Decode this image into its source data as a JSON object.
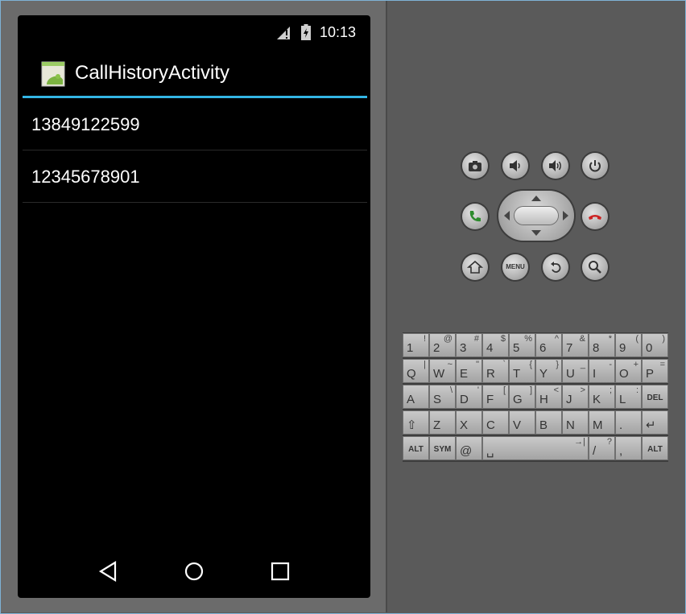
{
  "status_bar": {
    "time": "10:13"
  },
  "action_bar": {
    "title": "CallHistoryActivity"
  },
  "call_history": {
    "items": [
      {
        "number": "13849122599"
      },
      {
        "number": "12345678901"
      }
    ]
  },
  "colors": {
    "accent": "#33b5e5",
    "call_green": "#2e8b2e",
    "end_red": "#cc2222"
  },
  "hardware_buttons": {
    "row1": [
      "camera-icon",
      "volume-down-icon",
      "volume-up-icon",
      "power-icon"
    ],
    "row2": [
      "call-icon",
      "dpad",
      "end-call-icon"
    ],
    "row3": [
      "home-icon",
      "menu-button",
      "back-icon",
      "search-icon"
    ],
    "menu_label": "MENU"
  },
  "keyboard": {
    "rows": [
      [
        {
          "main": "1",
          "alt": "!"
        },
        {
          "main": "2",
          "alt": "@"
        },
        {
          "main": "3",
          "alt": "#"
        },
        {
          "main": "4",
          "alt": "$"
        },
        {
          "main": "5",
          "alt": "%"
        },
        {
          "main": "6",
          "alt": "^"
        },
        {
          "main": "7",
          "alt": "&"
        },
        {
          "main": "8",
          "alt": "*"
        },
        {
          "main": "9",
          "alt": "("
        },
        {
          "main": "0",
          "alt": ")"
        }
      ],
      [
        {
          "main": "Q",
          "alt": "|"
        },
        {
          "main": "W",
          "alt": "~"
        },
        {
          "main": "E",
          "alt": "\""
        },
        {
          "main": "R",
          "alt": "`"
        },
        {
          "main": "T",
          "alt": "{"
        },
        {
          "main": "Y",
          "alt": "}"
        },
        {
          "main": "U",
          "alt": "_"
        },
        {
          "main": "I",
          "alt": "-"
        },
        {
          "main": "O",
          "alt": "+"
        },
        {
          "main": "P",
          "alt": "="
        }
      ],
      [
        {
          "main": "A",
          "alt": ""
        },
        {
          "main": "S",
          "alt": "\\"
        },
        {
          "main": "D",
          "alt": "'"
        },
        {
          "main": "F",
          "alt": "["
        },
        {
          "main": "G",
          "alt": "]"
        },
        {
          "main": "H",
          "alt": "<"
        },
        {
          "main": "J",
          "alt": ">"
        },
        {
          "main": "K",
          "alt": ";"
        },
        {
          "main": "L",
          "alt": ":"
        },
        {
          "main": "DEL",
          "alt": ""
        }
      ],
      [
        {
          "main": "⇧",
          "alt": ""
        },
        {
          "main": "Z",
          "alt": ""
        },
        {
          "main": "X",
          "alt": ""
        },
        {
          "main": "C",
          "alt": ""
        },
        {
          "main": "V",
          "alt": ""
        },
        {
          "main": "B",
          "alt": ""
        },
        {
          "main": "N",
          "alt": ""
        },
        {
          "main": "M",
          "alt": ""
        },
        {
          "main": ".",
          "alt": ""
        },
        {
          "main": "↵",
          "alt": ""
        }
      ],
      [
        {
          "main": "ALT",
          "alt": ""
        },
        {
          "main": "SYM",
          "alt": ""
        },
        {
          "main": "@",
          "alt": ""
        },
        {
          "main": "␣",
          "alt": "→|"
        },
        {
          "main": "/",
          "alt": "?"
        },
        {
          "main": ",",
          "alt": ""
        },
        {
          "main": "ALT",
          "alt": ""
        }
      ]
    ]
  }
}
